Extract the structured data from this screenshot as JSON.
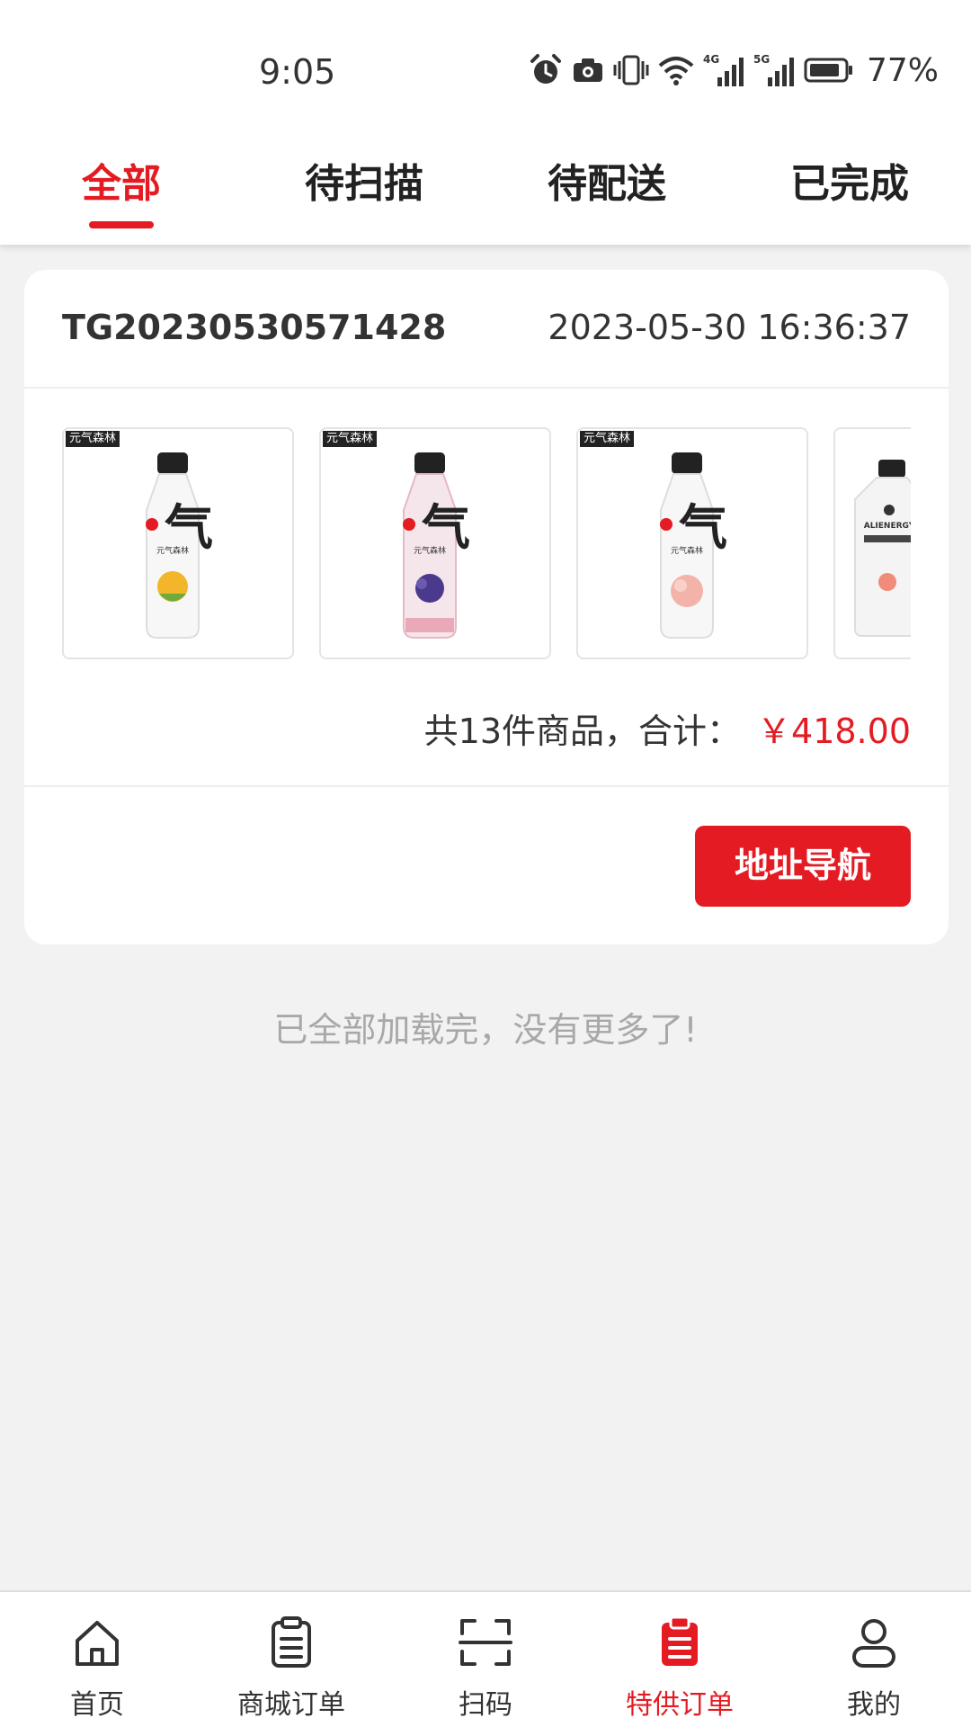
{
  "status_bar": {
    "time": "9:05",
    "battery": "77%",
    "icons": [
      "alarm-icon",
      "camera-icon",
      "vibrate-icon",
      "wifi-icon",
      "signal-4g-icon",
      "signal-5g-icon",
      "battery-icon"
    ],
    "network_labels": [
      "4G",
      "5G"
    ]
  },
  "tabs": [
    {
      "label": "全部",
      "active": true
    },
    {
      "label": "待扫描",
      "active": false
    },
    {
      "label": "待配送",
      "active": false
    },
    {
      "label": "已完成",
      "active": false
    }
  ],
  "order": {
    "number": "TG20230530571428",
    "datetime": "2023-05-30 16:36:37",
    "products": [
      {
        "brand_tag": "元气森林",
        "product_text": "元气森林",
        "flavor": "orange"
      },
      {
        "brand_tag": "元气森林",
        "product_text": "元气森林",
        "flavor": "grape"
      },
      {
        "brand_tag": "元气森林",
        "product_text": "元气森林",
        "flavor": "peach"
      },
      {
        "brand_tag": "",
        "product_text": "ALIENERGY",
        "flavor": "grapefruit"
      }
    ],
    "summary_text": "共13件商品，合计：",
    "total": "￥418.00",
    "nav_button": "地址导航"
  },
  "end_note": "已全部加载完，没有更多了!",
  "bottom_nav": [
    {
      "label": "首页",
      "icon": "home-icon",
      "active": false
    },
    {
      "label": "商城订单",
      "icon": "clipboard-list-icon",
      "active": false
    },
    {
      "label": "扫码",
      "icon": "scan-icon",
      "active": false
    },
    {
      "label": "特供订单",
      "icon": "clipboard-list-filled-icon",
      "active": true
    },
    {
      "label": "我的",
      "icon": "user-icon",
      "active": false
    }
  ],
  "colors": {
    "accent": "#e41b23",
    "background": "#f2f2f2",
    "text": "#333333",
    "muted_text": "#a8a8a8"
  }
}
